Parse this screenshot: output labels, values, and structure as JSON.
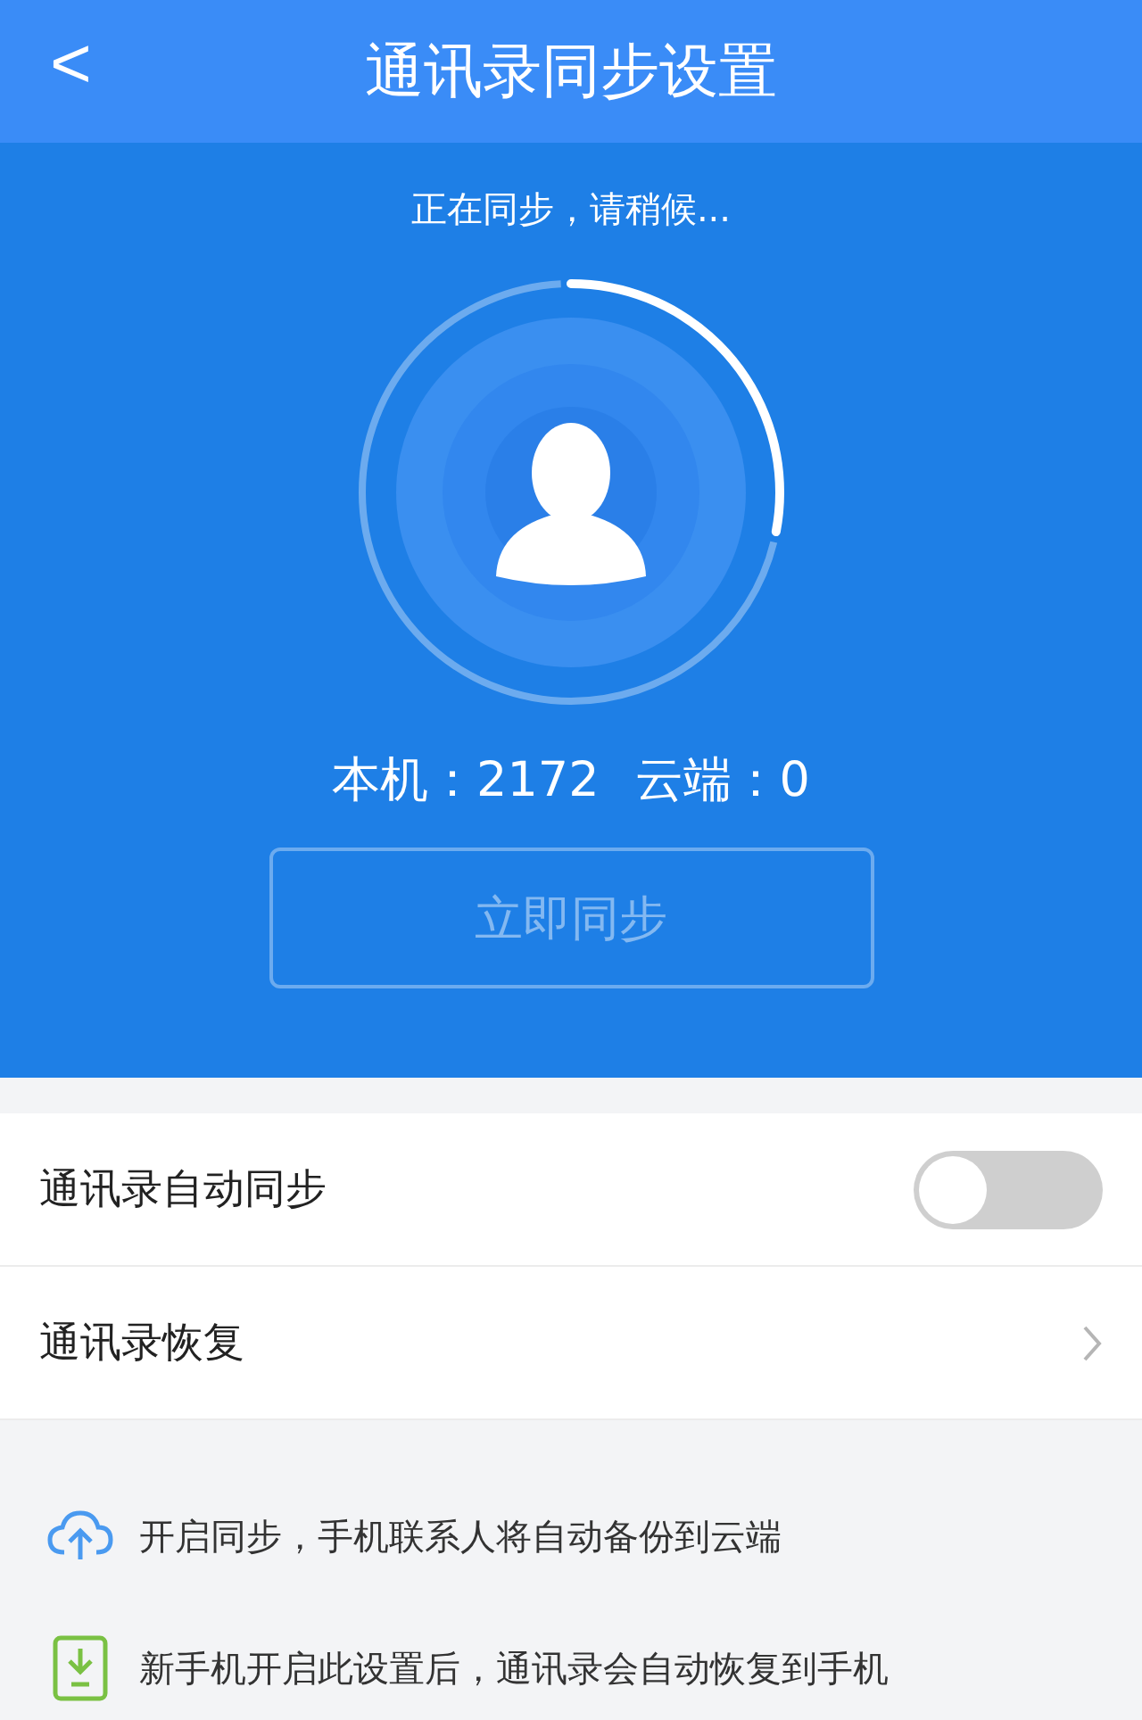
{
  "header": {
    "title": "通讯录同步设置",
    "back": "<"
  },
  "sync": {
    "status": "正在同步，请稍候...",
    "local_count": "本机：2172",
    "cloud_count": "云端：0",
    "button": {
      "label": "立即同步",
      "disabled": true
    }
  },
  "settings": [
    {
      "kind": "toggle",
      "label": "通讯录自动同步",
      "on": false
    },
    {
      "kind": "link",
      "label": "通讯录恢复"
    }
  ],
  "tips": [
    {
      "kind": "cloud",
      "text": "开启同步，手机联系人将自动备份到云端"
    },
    {
      "kind": "download",
      "text": "新手机开启此设置后，通讯录会自动恢复到手机"
    }
  ]
}
